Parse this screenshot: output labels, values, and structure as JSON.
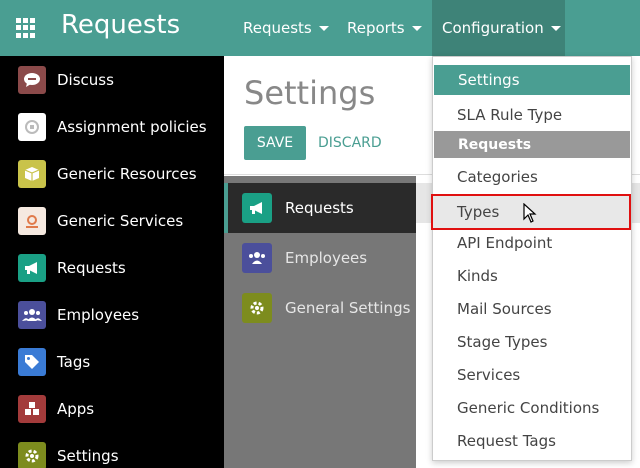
{
  "topbar": {
    "app_title": "Requests",
    "menus": [
      {
        "label": "Requests"
      },
      {
        "label": "Reports"
      },
      {
        "label": "Configuration"
      }
    ]
  },
  "sidebar": {
    "items": [
      {
        "label": "Discuss",
        "icon": "chat-bubble-icon",
        "color": "#8b4a4a"
      },
      {
        "label": "Assignment policies",
        "icon": "policy-icon",
        "color": "#ffffff"
      },
      {
        "label": "Generic Resources",
        "icon": "cube-icon",
        "color": "#c9c34a"
      },
      {
        "label": "Generic Services",
        "icon": "service-gear-icon",
        "color": "#f5e9e0"
      },
      {
        "label": "Requests",
        "icon": "megaphone-icon",
        "color": "#1aa085"
      },
      {
        "label": "Employees",
        "icon": "users-icon",
        "color": "#4b4f9b"
      },
      {
        "label": "Tags",
        "icon": "tag-icon",
        "color": "#3a7bd5"
      },
      {
        "label": "Apps",
        "icon": "apps-cubes-icon",
        "color": "#a33b3b"
      },
      {
        "label": "Settings",
        "icon": "gear-icon",
        "color": "#7d8c1e"
      }
    ]
  },
  "main": {
    "title": "Settings",
    "save_label": "SAVE",
    "discard_label": "DISCARD",
    "panel_items": [
      {
        "label": "Requests",
        "icon": "megaphone-icon",
        "color": "#1aa085"
      },
      {
        "label": "Employees",
        "icon": "users-icon",
        "color": "#4b4f9b"
      },
      {
        "label": "General Settings",
        "icon": "gear-icon",
        "color": "#7d8c1e"
      }
    ]
  },
  "dropdown": {
    "items": [
      {
        "label": "Settings",
        "kind": "active"
      },
      {
        "label": "SLA Rule Type",
        "kind": "item"
      },
      {
        "label": "Requests",
        "kind": "section"
      },
      {
        "label": "Categories",
        "kind": "item"
      },
      {
        "label": "Types",
        "kind": "hover"
      },
      {
        "label": "API Endpoint",
        "kind": "item"
      },
      {
        "label": "Kinds",
        "kind": "item"
      },
      {
        "label": "Mail Sources",
        "kind": "item"
      },
      {
        "label": "Stage Types",
        "kind": "item"
      },
      {
        "label": "Services",
        "kind": "item"
      },
      {
        "label": "Generic Conditions",
        "kind": "item"
      },
      {
        "label": "Request Tags",
        "kind": "item"
      }
    ]
  },
  "colors": {
    "brand": "#4a9e92",
    "highlight": "#e01010"
  }
}
